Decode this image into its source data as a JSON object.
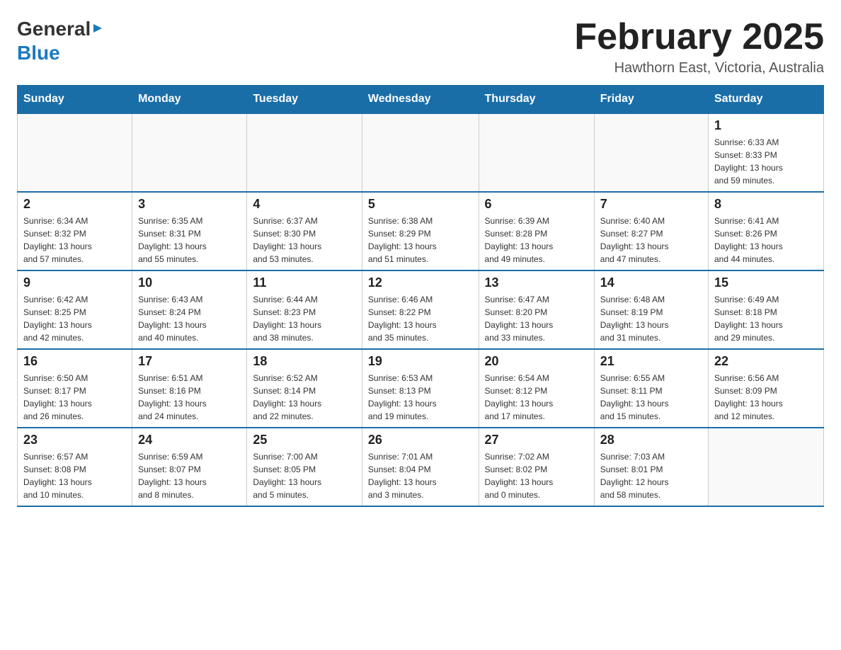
{
  "header": {
    "logo_general": "General",
    "logo_blue": "Blue",
    "month_title": "February 2025",
    "location": "Hawthorn East, Victoria, Australia"
  },
  "days_of_week": [
    "Sunday",
    "Monday",
    "Tuesday",
    "Wednesday",
    "Thursday",
    "Friday",
    "Saturday"
  ],
  "weeks": [
    {
      "days": [
        {
          "number": "",
          "info": ""
        },
        {
          "number": "",
          "info": ""
        },
        {
          "number": "",
          "info": ""
        },
        {
          "number": "",
          "info": ""
        },
        {
          "number": "",
          "info": ""
        },
        {
          "number": "",
          "info": ""
        },
        {
          "number": "1",
          "info": "Sunrise: 6:33 AM\nSunset: 8:33 PM\nDaylight: 13 hours\nand 59 minutes."
        }
      ]
    },
    {
      "days": [
        {
          "number": "2",
          "info": "Sunrise: 6:34 AM\nSunset: 8:32 PM\nDaylight: 13 hours\nand 57 minutes."
        },
        {
          "number": "3",
          "info": "Sunrise: 6:35 AM\nSunset: 8:31 PM\nDaylight: 13 hours\nand 55 minutes."
        },
        {
          "number": "4",
          "info": "Sunrise: 6:37 AM\nSunset: 8:30 PM\nDaylight: 13 hours\nand 53 minutes."
        },
        {
          "number": "5",
          "info": "Sunrise: 6:38 AM\nSunset: 8:29 PM\nDaylight: 13 hours\nand 51 minutes."
        },
        {
          "number": "6",
          "info": "Sunrise: 6:39 AM\nSunset: 8:28 PM\nDaylight: 13 hours\nand 49 minutes."
        },
        {
          "number": "7",
          "info": "Sunrise: 6:40 AM\nSunset: 8:27 PM\nDaylight: 13 hours\nand 47 minutes."
        },
        {
          "number": "8",
          "info": "Sunrise: 6:41 AM\nSunset: 8:26 PM\nDaylight: 13 hours\nand 44 minutes."
        }
      ]
    },
    {
      "days": [
        {
          "number": "9",
          "info": "Sunrise: 6:42 AM\nSunset: 8:25 PM\nDaylight: 13 hours\nand 42 minutes."
        },
        {
          "number": "10",
          "info": "Sunrise: 6:43 AM\nSunset: 8:24 PM\nDaylight: 13 hours\nand 40 minutes."
        },
        {
          "number": "11",
          "info": "Sunrise: 6:44 AM\nSunset: 8:23 PM\nDaylight: 13 hours\nand 38 minutes."
        },
        {
          "number": "12",
          "info": "Sunrise: 6:46 AM\nSunset: 8:22 PM\nDaylight: 13 hours\nand 35 minutes."
        },
        {
          "number": "13",
          "info": "Sunrise: 6:47 AM\nSunset: 8:20 PM\nDaylight: 13 hours\nand 33 minutes."
        },
        {
          "number": "14",
          "info": "Sunrise: 6:48 AM\nSunset: 8:19 PM\nDaylight: 13 hours\nand 31 minutes."
        },
        {
          "number": "15",
          "info": "Sunrise: 6:49 AM\nSunset: 8:18 PM\nDaylight: 13 hours\nand 29 minutes."
        }
      ]
    },
    {
      "days": [
        {
          "number": "16",
          "info": "Sunrise: 6:50 AM\nSunset: 8:17 PM\nDaylight: 13 hours\nand 26 minutes."
        },
        {
          "number": "17",
          "info": "Sunrise: 6:51 AM\nSunset: 8:16 PM\nDaylight: 13 hours\nand 24 minutes."
        },
        {
          "number": "18",
          "info": "Sunrise: 6:52 AM\nSunset: 8:14 PM\nDaylight: 13 hours\nand 22 minutes."
        },
        {
          "number": "19",
          "info": "Sunrise: 6:53 AM\nSunset: 8:13 PM\nDaylight: 13 hours\nand 19 minutes."
        },
        {
          "number": "20",
          "info": "Sunrise: 6:54 AM\nSunset: 8:12 PM\nDaylight: 13 hours\nand 17 minutes."
        },
        {
          "number": "21",
          "info": "Sunrise: 6:55 AM\nSunset: 8:11 PM\nDaylight: 13 hours\nand 15 minutes."
        },
        {
          "number": "22",
          "info": "Sunrise: 6:56 AM\nSunset: 8:09 PM\nDaylight: 13 hours\nand 12 minutes."
        }
      ]
    },
    {
      "days": [
        {
          "number": "23",
          "info": "Sunrise: 6:57 AM\nSunset: 8:08 PM\nDaylight: 13 hours\nand 10 minutes."
        },
        {
          "number": "24",
          "info": "Sunrise: 6:59 AM\nSunset: 8:07 PM\nDaylight: 13 hours\nand 8 minutes."
        },
        {
          "number": "25",
          "info": "Sunrise: 7:00 AM\nSunset: 8:05 PM\nDaylight: 13 hours\nand 5 minutes."
        },
        {
          "number": "26",
          "info": "Sunrise: 7:01 AM\nSunset: 8:04 PM\nDaylight: 13 hours\nand 3 minutes."
        },
        {
          "number": "27",
          "info": "Sunrise: 7:02 AM\nSunset: 8:02 PM\nDaylight: 13 hours\nand 0 minutes."
        },
        {
          "number": "28",
          "info": "Sunrise: 7:03 AM\nSunset: 8:01 PM\nDaylight: 12 hours\nand 58 minutes."
        },
        {
          "number": "",
          "info": ""
        }
      ]
    }
  ]
}
